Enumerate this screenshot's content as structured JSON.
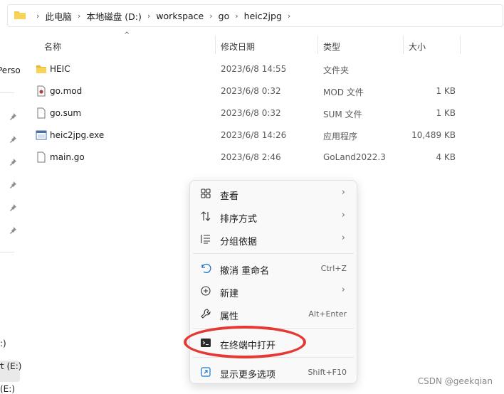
{
  "breadcrumb": [
    "此电脑",
    "本地磁盘 (D:)",
    "workspace",
    "go",
    "heic2jpg"
  ],
  "leftnav": {
    "top_fragment": "Perso",
    "bottom_items": [
      ":)",
      "rt (E:)",
      "(E:)"
    ]
  },
  "columns": {
    "name": "名称",
    "date": "修改日期",
    "type": "类型",
    "size": "大小"
  },
  "files": [
    {
      "icon": "folder-icon",
      "name": "HEIC",
      "date": "2023/6/8 14:55",
      "type": "文件夹",
      "size": ""
    },
    {
      "icon": "mod-file-icon",
      "name": "go.mod",
      "date": "2023/6/8 0:32",
      "type": "MOD 文件",
      "size": "1 KB"
    },
    {
      "icon": "file-icon",
      "name": "go.sum",
      "date": "2023/6/8 0:32",
      "type": "SUM 文件",
      "size": "1 KB"
    },
    {
      "icon": "exe-icon",
      "name": "heic2jpg.exe",
      "date": "2023/6/8 14:26",
      "type": "应用程序",
      "size": "10,489 KB"
    },
    {
      "icon": "file-icon",
      "name": "main.go",
      "date": "2023/6/8 2:46",
      "type": "GoLand2022.3",
      "size": "4 KB"
    }
  ],
  "context_menu": {
    "items": [
      {
        "icon": "grid-view-icon",
        "label": "查看",
        "shortcut": "",
        "submenu": true
      },
      {
        "icon": "sort-icon",
        "label": "排序方式",
        "shortcut": "",
        "submenu": true
      },
      {
        "icon": "group-by-icon",
        "label": "分组依据",
        "shortcut": "",
        "submenu": true
      },
      {
        "icon": "undo-icon",
        "label": "撤消 重命名",
        "shortcut": "Ctrl+Z",
        "submenu": false
      },
      {
        "icon": "new-icon",
        "label": "新建",
        "shortcut": "",
        "submenu": true
      },
      {
        "icon": "wrench-icon",
        "label": "属性",
        "shortcut": "Alt+Enter",
        "submenu": false
      },
      {
        "icon": "terminal-icon",
        "label": "在终端中打开",
        "shortcut": "",
        "submenu": false
      },
      {
        "icon": "expand-icon",
        "label": "显示更多选项",
        "shortcut": "Shift+F10",
        "submenu": false
      }
    ]
  },
  "colors": {
    "highlight": "#e53935",
    "folder": "#f2c744",
    "menu_bg": "#f9f9f9"
  },
  "watermark": "CSDN @geekqian"
}
